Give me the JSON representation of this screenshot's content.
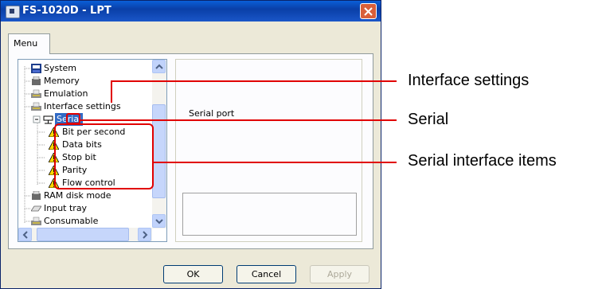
{
  "window": {
    "title": "FS-1020D - LPT",
    "tab_label": "Menu"
  },
  "tree": {
    "items": [
      {
        "label": "System",
        "icon": "system-icon"
      },
      {
        "label": "Memory",
        "icon": "memory-icon"
      },
      {
        "label": "Emulation",
        "icon": "printer-icon"
      },
      {
        "label": "Interface settings",
        "icon": "printer-icon"
      },
      {
        "label": "Serial",
        "icon": "serial-port-icon",
        "selected": true
      },
      {
        "label": "Bit per second",
        "icon": "warning-icon"
      },
      {
        "label": "Data bits",
        "icon": "warning-icon"
      },
      {
        "label": "Stop bit",
        "icon": "warning-icon"
      },
      {
        "label": "Parity",
        "icon": "warning-icon"
      },
      {
        "label": "Flow control",
        "icon": "warning-icon"
      },
      {
        "label": "RAM disk mode",
        "icon": "memory-icon"
      },
      {
        "label": "Input tray",
        "icon": "tray-icon"
      },
      {
        "label": "Consumable",
        "icon": "printer-icon"
      }
    ]
  },
  "detail": {
    "label": "Serial port"
  },
  "buttons": {
    "ok": "OK",
    "cancel": "Cancel",
    "apply": "Apply"
  },
  "callouts": {
    "interface_settings": "Interface settings",
    "serial": "Serial",
    "serial_items": "Serial interface items"
  },
  "colors": {
    "callout_red": "#e10000",
    "title_blue": "#0a3fa8",
    "selection": "#316ac5"
  }
}
